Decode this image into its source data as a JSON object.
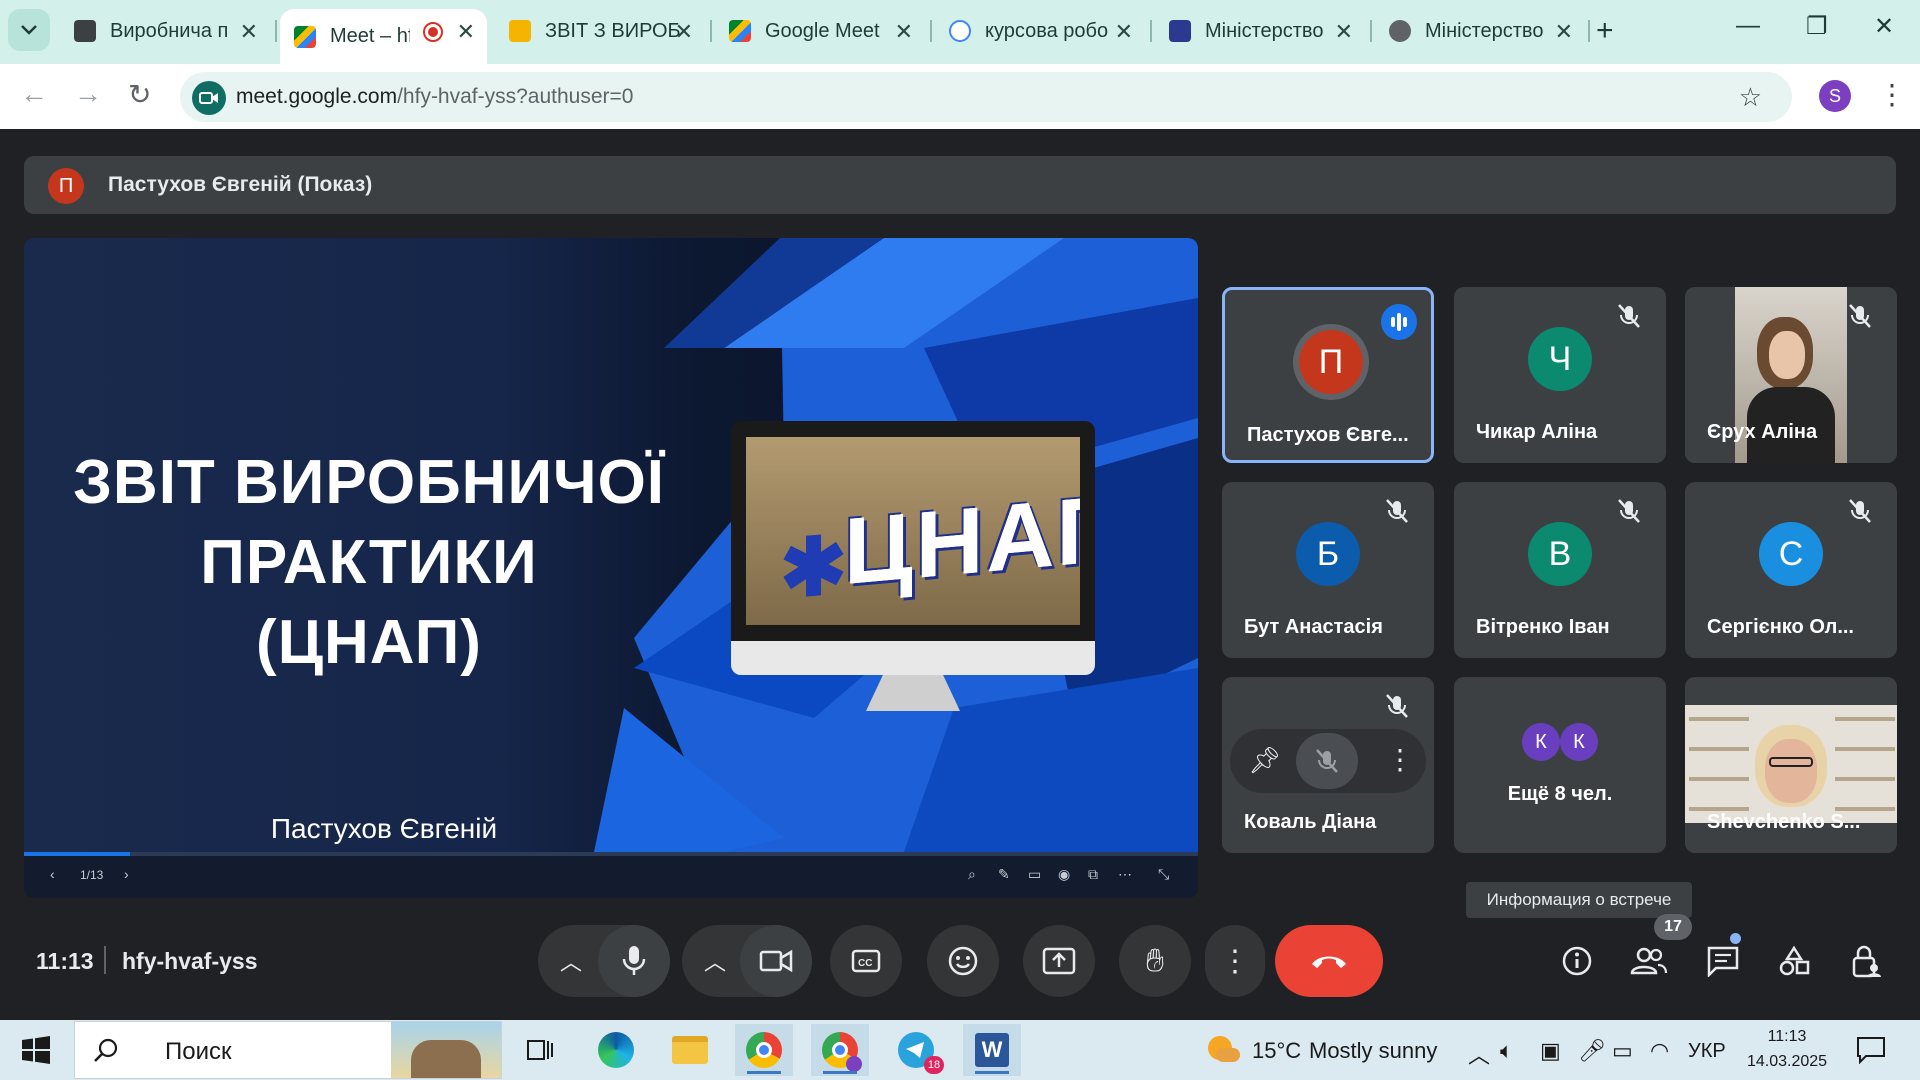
{
  "browser": {
    "tabs": [
      {
        "title": "Виробнича п",
        "active": false
      },
      {
        "title": "Meet – hfy",
        "active": true
      },
      {
        "title": "ЗВІТ З ВИРОБ",
        "active": false
      },
      {
        "title": "Google Meet",
        "active": false
      },
      {
        "title": "курсова робо",
        "active": false
      },
      {
        "title": "Міністерство",
        "active": false
      },
      {
        "title": "Міністерство",
        "active": false
      }
    ],
    "url_host": "meet.google.com",
    "url_rest": "/hfy-hvaf-yss?authuser=0",
    "profile_initial": "S"
  },
  "meet": {
    "presenter_initial": "П",
    "presenter_label": "Пастухов Євгеній (Показ)",
    "slide": {
      "title_lines": [
        "ЗВІТ ВИРОБНИЧОЇ",
        "ПРАКТИКИ",
        "(ЦНАП)"
      ],
      "sign_text": "ЦНАП",
      "author": "Пастухов Євгеній",
      "page": "1/13",
      "progress": 0.09
    },
    "tiles": [
      {
        "initial": "П",
        "name": "Пастухов Євге...",
        "color": "#c5371d",
        "speaking": true
      },
      {
        "initial": "Ч",
        "name": "Чикар Аліна",
        "color": "#0b8a6f",
        "muted": true
      },
      {
        "initial": "",
        "name": "Єрух Аліна",
        "muted": true,
        "video": true
      },
      {
        "initial": "Б",
        "name": "Бут Анастасія",
        "color": "#0b5cad",
        "muted": true
      },
      {
        "initial": "В",
        "name": "Вітренко Іван",
        "color": "#0b8a6f",
        "muted": true
      },
      {
        "initial": "С",
        "name": "Сергієнко Ол...",
        "color": "#1a8fe0",
        "muted": true
      },
      {
        "initial": "",
        "name": "Коваль Діана",
        "muted": true,
        "hover": true
      },
      {
        "initial": "К",
        "initial2": "К",
        "name": "Ещё 8 чел.",
        "color": "#6a3fbf"
      },
      {
        "initial": "",
        "name": "Shevchenko S...",
        "video": true
      }
    ],
    "tooltip": "Информация о встрече",
    "time": "11:13",
    "meeting_code": "hfy-hvaf-yss",
    "participants_count": "17"
  },
  "taskbar": {
    "search_placeholder": "Поиск",
    "weather_temp": "15°C",
    "weather_text": "Mostly sunny",
    "lang": "УКР",
    "clock_time": "11:13",
    "clock_date": "14.03.2025",
    "telegram_badge": "18"
  }
}
